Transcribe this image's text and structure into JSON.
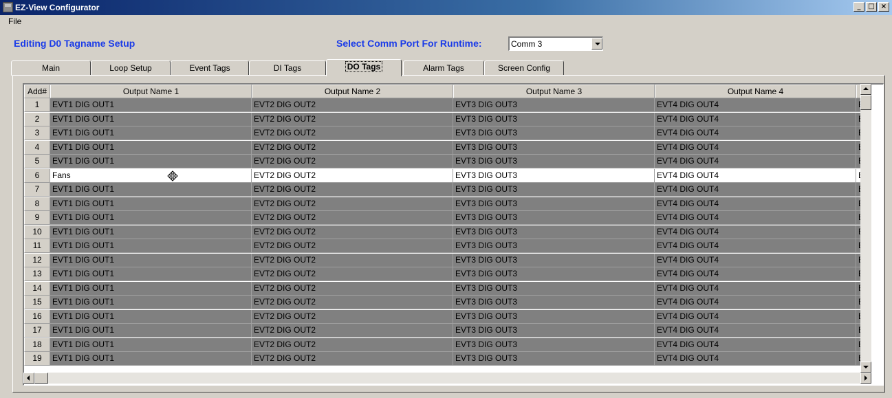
{
  "window": {
    "title": "EZ-View Configurator",
    "min_glyph": "_",
    "max_glyph": "□",
    "close_glyph": "×"
  },
  "menu": {
    "file": "File"
  },
  "editing_title": "Editing D0 Tagname Setup",
  "comm": {
    "label": "Select Comm Port For Runtime:",
    "value": "Comm 3"
  },
  "tabs": [
    {
      "label": "Main",
      "active": false
    },
    {
      "label": "Loop Setup",
      "active": false
    },
    {
      "label": "Event Tags",
      "active": false
    },
    {
      "label": "DI Tags",
      "active": false
    },
    {
      "label": "DO Tags",
      "active": true
    },
    {
      "label": "Alarm Tags",
      "active": false
    },
    {
      "label": "Screen Config",
      "active": false
    }
  ],
  "grid": {
    "columns": [
      "Add#",
      "Output Name 1",
      "Output Name 2",
      "Output Name 3",
      "Output Name 4"
    ],
    "selected_row": 6,
    "rows": [
      {
        "num": "1",
        "cells": [
          "EVT1 DIG OUT1",
          "EVT2 DIG OUT2",
          "EVT3 DIG OUT3",
          "EVT4 DIG OUT4",
          "E"
        ]
      },
      {
        "num": "2",
        "cells": [
          "EVT1 DIG OUT1",
          "EVT2 DIG OUT2",
          "EVT3 DIG OUT3",
          "EVT4 DIG OUT4",
          "E"
        ]
      },
      {
        "num": "3",
        "cells": [
          "EVT1 DIG OUT1",
          "EVT2 DIG OUT2",
          "EVT3 DIG OUT3",
          "EVT4 DIG OUT4",
          "E"
        ]
      },
      {
        "num": "4",
        "cells": [
          "EVT1 DIG OUT1",
          "EVT2 DIG OUT2",
          "EVT3 DIG OUT3",
          "EVT4 DIG OUT4",
          "E"
        ]
      },
      {
        "num": "5",
        "cells": [
          "EVT1 DIG OUT1",
          "EVT2 DIG OUT2",
          "EVT3 DIG OUT3",
          "EVT4 DIG OUT4",
          "E"
        ]
      },
      {
        "num": "6",
        "cells": [
          "Fans",
          "EVT2 DIG OUT2",
          "EVT3 DIG OUT3",
          "EVT4 DIG OUT4",
          "E"
        ]
      },
      {
        "num": "7",
        "cells": [
          "EVT1 DIG OUT1",
          "EVT2 DIG OUT2",
          "EVT3 DIG OUT3",
          "EVT4 DIG OUT4",
          "E"
        ]
      },
      {
        "num": "8",
        "cells": [
          "EVT1 DIG OUT1",
          "EVT2 DIG OUT2",
          "EVT3 DIG OUT3",
          "EVT4 DIG OUT4",
          "E"
        ]
      },
      {
        "num": "9",
        "cells": [
          "EVT1 DIG OUT1",
          "EVT2 DIG OUT2",
          "EVT3 DIG OUT3",
          "EVT4 DIG OUT4",
          "E"
        ]
      },
      {
        "num": "10",
        "cells": [
          "EVT1 DIG OUT1",
          "EVT2 DIG OUT2",
          "EVT3 DIG OUT3",
          "EVT4 DIG OUT4",
          "E"
        ]
      },
      {
        "num": "11",
        "cells": [
          "EVT1 DIG OUT1",
          "EVT2 DIG OUT2",
          "EVT3 DIG OUT3",
          "EVT4 DIG OUT4",
          "E"
        ]
      },
      {
        "num": "12",
        "cells": [
          "EVT1 DIG OUT1",
          "EVT2 DIG OUT2",
          "EVT3 DIG OUT3",
          "EVT4 DIG OUT4",
          "E"
        ]
      },
      {
        "num": "13",
        "cells": [
          "EVT1 DIG OUT1",
          "EVT2 DIG OUT2",
          "EVT3 DIG OUT3",
          "EVT4 DIG OUT4",
          "E"
        ]
      },
      {
        "num": "14",
        "cells": [
          "EVT1 DIG OUT1",
          "EVT2 DIG OUT2",
          "EVT3 DIG OUT3",
          "EVT4 DIG OUT4",
          "E"
        ]
      },
      {
        "num": "15",
        "cells": [
          "EVT1 DIG OUT1",
          "EVT2 DIG OUT2",
          "EVT3 DIG OUT3",
          "EVT4 DIG OUT4",
          "E"
        ]
      },
      {
        "num": "16",
        "cells": [
          "EVT1 DIG OUT1",
          "EVT2 DIG OUT2",
          "EVT3 DIG OUT3",
          "EVT4 DIG OUT4",
          "E"
        ]
      },
      {
        "num": "17",
        "cells": [
          "EVT1 DIG OUT1",
          "EVT2 DIG OUT2",
          "EVT3 DIG OUT3",
          "EVT4 DIG OUT4",
          "E"
        ]
      },
      {
        "num": "18",
        "cells": [
          "EVT1 DIG OUT1",
          "EVT2 DIG OUT2",
          "EVT3 DIG OUT3",
          "EVT4 DIG OUT4",
          "E"
        ]
      },
      {
        "num": "19",
        "cells": [
          "EVT1 DIG OUT1",
          "EVT2 DIG OUT2",
          "EVT3 DIG OUT3",
          "EVT4 DIG OUT4",
          "E"
        ]
      }
    ]
  },
  "colors": {
    "heading_blue": "#1a3be8",
    "grid_cell_gray": "#808080",
    "selected_row_bg": "#ffffff",
    "titlebar_dark": "#0a246a"
  }
}
